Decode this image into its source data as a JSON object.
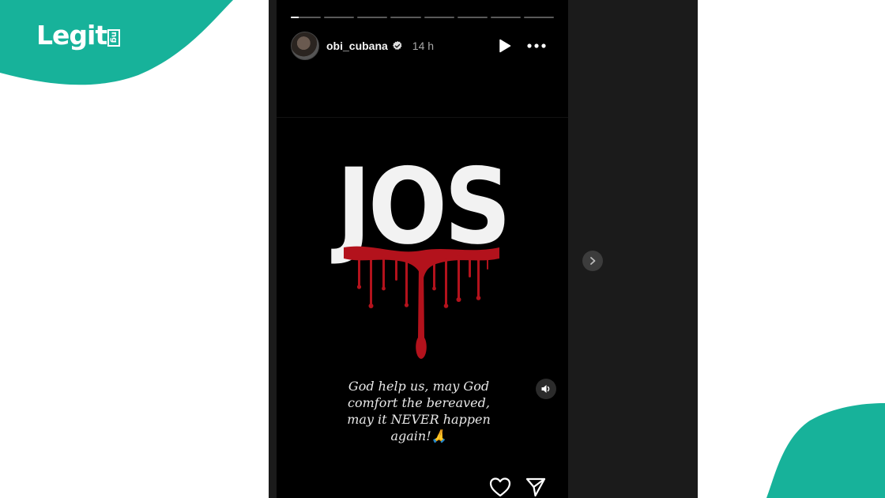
{
  "brand": {
    "logo_text": "Legit",
    "logo_suffix": "ng",
    "accent_color": "#17b29a"
  },
  "story": {
    "username": "obi_cubana",
    "verified": true,
    "timestamp": "14 h",
    "progress_segments": 8,
    "active_segment_progress": 0.25,
    "headline": "JOS",
    "caption": "God help us, may God comfort the bereaved, may it NEVER happen again!🙏"
  },
  "icons": {
    "play": "play-icon",
    "more": "more-icon",
    "verified": "verified-badge-icon",
    "mute": "speaker-icon",
    "next": "chevron-right-icon",
    "like": "heart-icon",
    "share": "paper-plane-icon"
  }
}
